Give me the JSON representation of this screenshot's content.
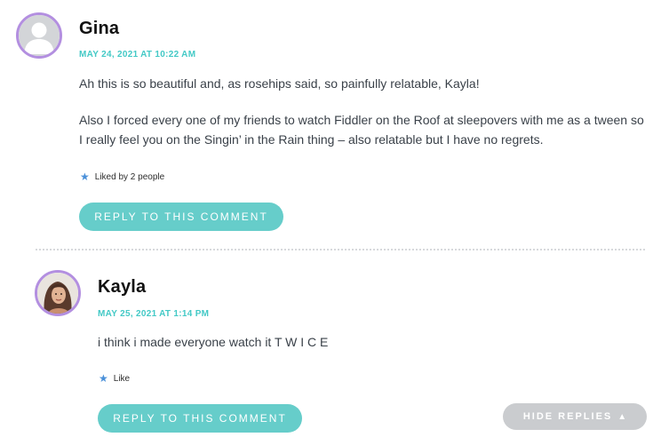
{
  "comments": [
    {
      "author": "Gina",
      "date": "MAY 24, 2021 AT 10:22 AM",
      "paragraphs": [
        "Ah this is so beautiful and, as rosehips said, so painfully relatable, Kayla!",
        "Also I forced every one of my friends to watch Fiddler on the Roof at sleepovers with me as a tween so I really feel you on the Singin’ in the Rain thing – also relatable but I have no regrets."
      ],
      "like_text": "Liked by 2 people",
      "reply_label": "REPLY TO THIS COMMENT",
      "avatar_icon": "default-user-avatar"
    },
    {
      "author": "Kayla",
      "date": "MAY 25, 2021 AT 1:14 PM",
      "paragraphs": [
        "i think i made everyone watch it T W I C E"
      ],
      "like_text": "Like",
      "reply_label": "REPLY TO THIS COMMENT",
      "avatar_icon": "user-photo-avatar"
    }
  ],
  "hide_replies": {
    "label": "HIDE REPLIES",
    "arrow": "▲"
  },
  "icons": {
    "like": "star-icon"
  },
  "colors": {
    "accent": "#43c9c6",
    "button": "#66cdca",
    "avatar_ring": "#b38fe0",
    "hide_button": "#cacccf",
    "star": "#4a90d9"
  }
}
